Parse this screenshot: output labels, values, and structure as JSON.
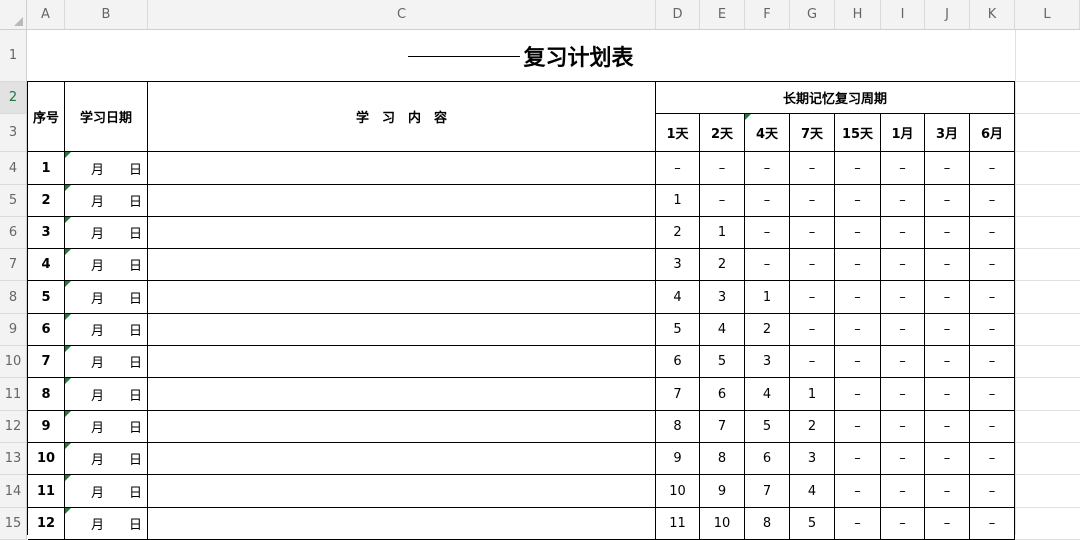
{
  "columns": [
    "A",
    "B",
    "C",
    "D",
    "E",
    "F",
    "G",
    "H",
    "I",
    "J",
    "K",
    "L"
  ],
  "title": "复习计划表",
  "headers": {
    "seq": "序号",
    "date": "学习日期",
    "content": "学　习　内　容",
    "cycle": "长期记忆复习周期",
    "intervals": [
      "1天",
      "2天",
      "4天",
      "7天",
      "15天",
      "1月",
      "3月",
      "6月"
    ]
  },
  "date_labels": {
    "month": "月",
    "day": "日"
  },
  "rows": [
    {
      "num": "1",
      "cycle": [
        "–",
        "–",
        "–",
        "–",
        "–",
        "–",
        "–",
        "–"
      ]
    },
    {
      "num": "2",
      "cycle": [
        "1",
        "–",
        "–",
        "–",
        "–",
        "–",
        "–",
        "–"
      ]
    },
    {
      "num": "3",
      "cycle": [
        "2",
        "1",
        "–",
        "–",
        "–",
        "–",
        "–",
        "–"
      ]
    },
    {
      "num": "4",
      "cycle": [
        "3",
        "2",
        "–",
        "–",
        "–",
        "–",
        "–",
        "–"
      ]
    },
    {
      "num": "5",
      "cycle": [
        "4",
        "3",
        "1",
        "–",
        "–",
        "–",
        "–",
        "–"
      ]
    },
    {
      "num": "6",
      "cycle": [
        "5",
        "4",
        "2",
        "–",
        "–",
        "–",
        "–",
        "–"
      ]
    },
    {
      "num": "7",
      "cycle": [
        "6",
        "5",
        "3",
        "–",
        "–",
        "–",
        "–",
        "–"
      ]
    },
    {
      "num": "8",
      "cycle": [
        "7",
        "6",
        "4",
        "1",
        "–",
        "–",
        "–",
        "–"
      ]
    },
    {
      "num": "9",
      "cycle": [
        "8",
        "7",
        "5",
        "2",
        "–",
        "–",
        "–",
        "–"
      ]
    },
    {
      "num": "10",
      "cycle": [
        "9",
        "8",
        "6",
        "3",
        "–",
        "–",
        "–",
        "–"
      ]
    },
    {
      "num": "11",
      "cycle": [
        "10",
        "9",
        "7",
        "4",
        "–",
        "–",
        "–",
        "–"
      ]
    },
    {
      "num": "12",
      "cycle": [
        "11",
        "10",
        "8",
        "5",
        "–",
        "–",
        "–",
        "–"
      ]
    }
  ],
  "row_numbers": [
    "1",
    "2",
    "3",
    "4",
    "5",
    "6",
    "7",
    "8",
    "9",
    "10",
    "11",
    "12",
    "13",
    "14",
    "15"
  ],
  "selected_row": "2"
}
